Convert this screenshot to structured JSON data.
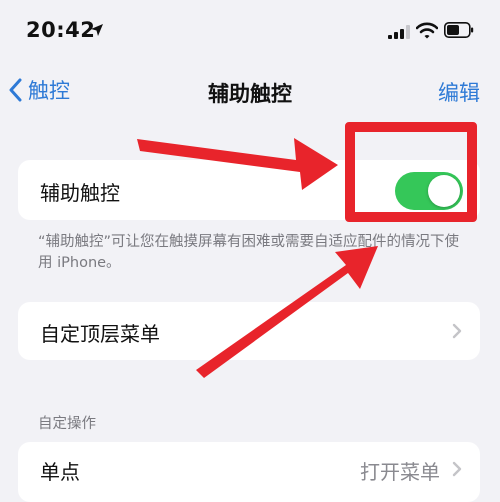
{
  "status_bar": {
    "time": "20:42",
    "icons": [
      "location-arrow-icon",
      "cellular-signal-icon",
      "wifi-icon",
      "battery-icon"
    ]
  },
  "nav_bar": {
    "back_label": "触控",
    "title": "辅助触控",
    "edit_label": "编辑"
  },
  "assistive_touch": {
    "label": "辅助触控",
    "toggle_on": true,
    "toggle_color": "#35c759",
    "description": "“辅助触控”可让您在触摸屏幕有困难或需要自适应配件的情况下使用 iPhone。"
  },
  "customize_menu": {
    "label": "自定顶层菜单"
  },
  "custom_actions": {
    "section_header": "自定操作",
    "rows": [
      {
        "label": "单点",
        "value": "打开菜单"
      }
    ]
  },
  "annotation": {
    "color": "#e8242b"
  },
  "colors": {
    "accent": "#2e7ad6",
    "background": "#f2f2f6",
    "secondary_text": "#7a7a80"
  }
}
